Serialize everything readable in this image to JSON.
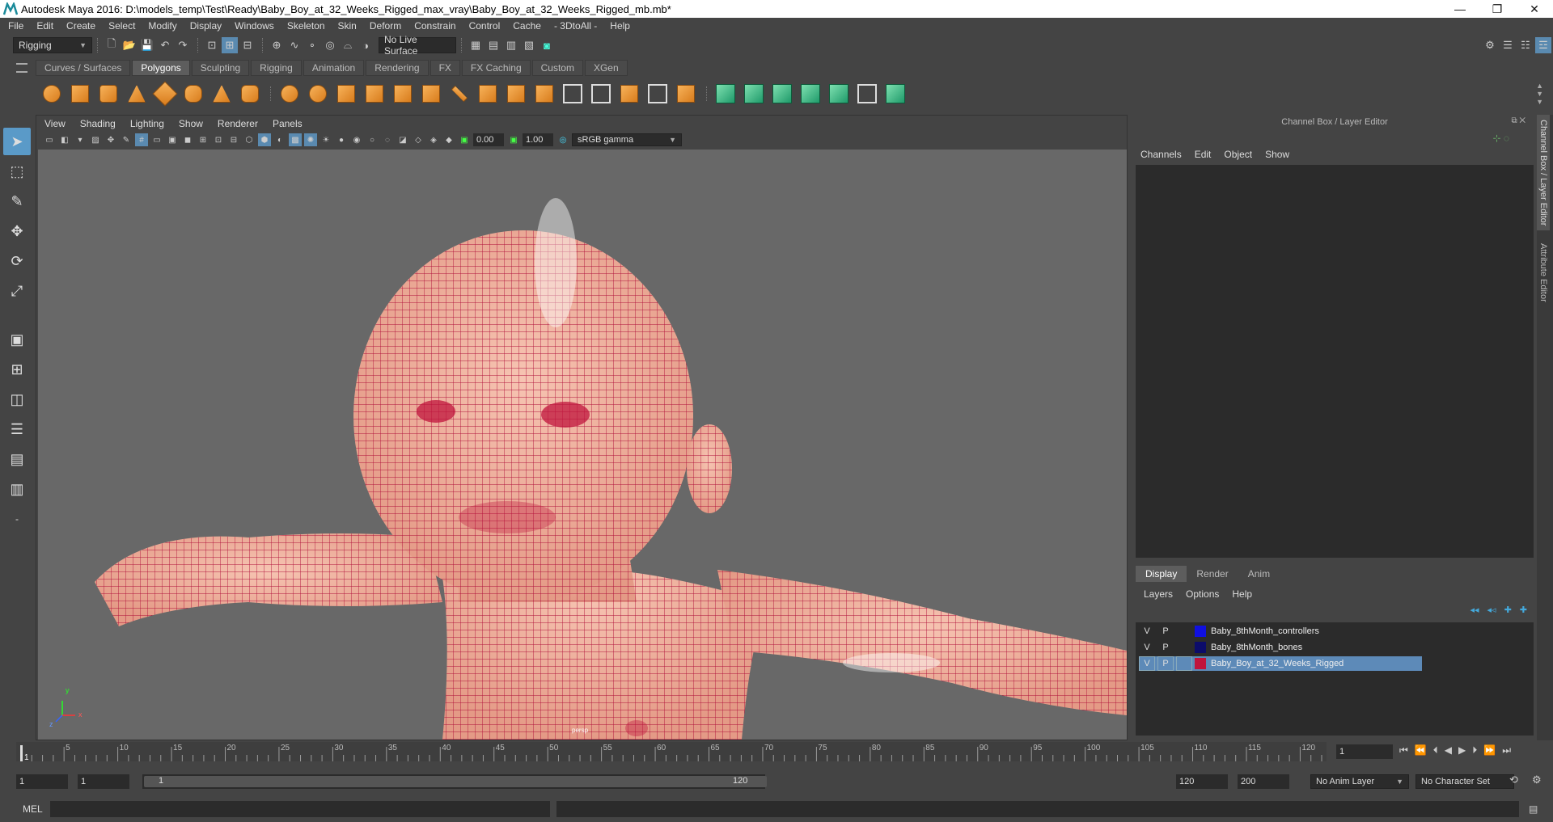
{
  "window": {
    "title": "Autodesk Maya 2016: D:\\models_temp\\Test\\Ready\\Baby_Boy_at_32_Weeks_Rigged_max_vray\\Baby_Boy_at_32_Weeks_Rigged_mb.mb*",
    "minimize": "—",
    "restore": "❐",
    "close": "✕"
  },
  "menubar": [
    "File",
    "Edit",
    "Create",
    "Select",
    "Modify",
    "Display",
    "Windows",
    "Skeleton",
    "Skin",
    "Deform",
    "Constrain",
    "Control",
    "Cache",
    "- 3DtoAll -",
    "Help"
  ],
  "statusline": {
    "menuset": "Rigging",
    "live_surface": "No Live Surface"
  },
  "shelf_tabs": [
    "Curves / Surfaces",
    "Polygons",
    "Sculpting",
    "Rigging",
    "Animation",
    "Rendering",
    "FX",
    "FX Caching",
    "Custom",
    "XGen"
  ],
  "shelf_active": "Polygons",
  "viewport": {
    "menu": [
      "View",
      "Shading",
      "Lighting",
      "Show",
      "Renderer",
      "Panels"
    ],
    "exposure": "0.00",
    "gamma": "1.00",
    "color_space": "sRGB gamma",
    "axis_x": "x",
    "axis_y": "y",
    "axis_z": "z",
    "camera_label": "persp"
  },
  "channel_box": {
    "title": "Channel Box / Layer Editor",
    "menu": [
      "Channels",
      "Edit",
      "Object",
      "Show"
    ]
  },
  "layer_editor": {
    "tabs": [
      "Display",
      "Render",
      "Anim"
    ],
    "active_tab": "Display",
    "menu": [
      "Layers",
      "Options",
      "Help"
    ],
    "layers": [
      {
        "v": "V",
        "p": "P",
        "color": "#1010e0",
        "name": "Baby_8thMonth_controllers",
        "selected": false
      },
      {
        "v": "V",
        "p": "P",
        "color": "#0c0c6a",
        "name": "Baby_8thMonth_bones",
        "selected": false
      },
      {
        "v": "V",
        "p": "P",
        "color": "#c0143c",
        "name": "Baby_Boy_at_32_Weeks_Rigged",
        "selected": true
      }
    ]
  },
  "side_tabs": [
    "Channel Box / Layer Editor",
    "Attribute Editor"
  ],
  "timeline": {
    "ticks": [
      "5",
      "10",
      "15",
      "20",
      "25",
      "30",
      "35",
      "40",
      "45",
      "50",
      "55",
      "60",
      "65",
      "70",
      "75",
      "80",
      "85",
      "90",
      "95",
      "100",
      "105",
      "110",
      "115",
      "120"
    ],
    "current_frame_marker": "1",
    "current_frame": "1"
  },
  "range": {
    "start": "1",
    "playback_start": "1",
    "slider_start": "1",
    "slider_end": "120",
    "playback_end": "120",
    "end": "200",
    "anim_layer": "No Anim Layer",
    "character_set": "No Character Set"
  },
  "command": {
    "label": "MEL"
  }
}
